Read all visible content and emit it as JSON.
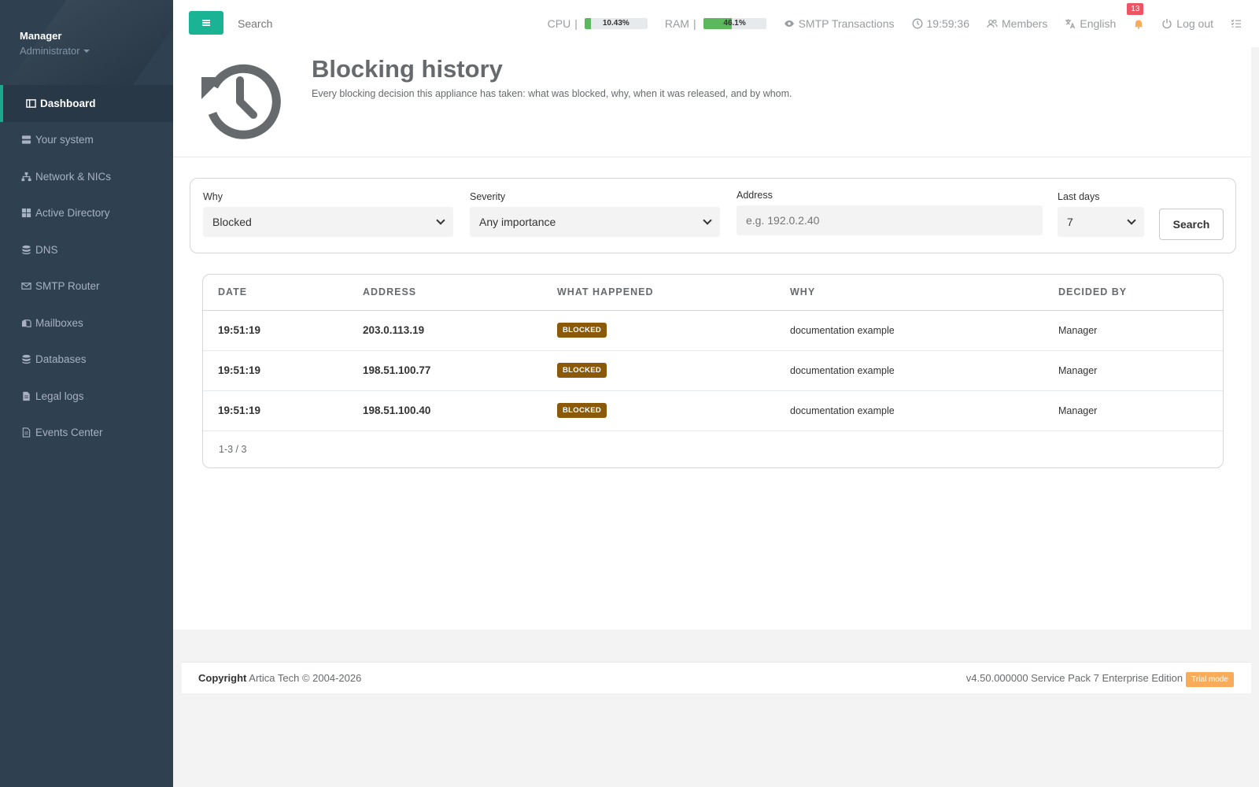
{
  "sidebar": {
    "user_name": "Manager",
    "user_role": "Administrator",
    "items": [
      {
        "label": "Dashboard",
        "icon": "dashboard-icon"
      },
      {
        "label": "Your system",
        "icon": "server-icon"
      },
      {
        "label": "Network & NICs",
        "icon": "network-icon"
      },
      {
        "label": "Active Directory",
        "icon": "windows-icon"
      },
      {
        "label": "DNS",
        "icon": "database-icon"
      },
      {
        "label": "SMTP Router",
        "icon": "envelope-icon"
      },
      {
        "label": "Mailboxes",
        "icon": "mailbox-icon"
      },
      {
        "label": "Databases",
        "icon": "database-icon"
      },
      {
        "label": "Legal logs",
        "icon": "file-icon"
      },
      {
        "label": "Events Center",
        "icon": "file-list-icon"
      }
    ]
  },
  "topbar": {
    "search_placeholder": "Search",
    "cpu_label": "CPU",
    "cpu_value": "10.43%",
    "cpu_fraction": 0.1043,
    "ram_label": "RAM",
    "ram_value": "46.1%",
    "ram_fraction": 0.461,
    "smtp_label": "SMTP Transactions",
    "time": "19:59:36",
    "members_label": "Members",
    "language": "English",
    "notifications_count": "13",
    "logout_label": "Log out"
  },
  "header": {
    "title": "Blocking history",
    "description": "Every blocking decision this appliance has taken: what was blocked, why, when it was released, and by whom."
  },
  "filters": {
    "why_label": "Why",
    "why_value": "Blocked",
    "severity_label": "Severity",
    "severity_value": "Any importance",
    "address_label": "Address",
    "address_placeholder": "e.g. 192.0.2.40",
    "last_days_label": "Last days",
    "last_days_value": "7",
    "search_button": "Search"
  },
  "table": {
    "columns": [
      "DATE",
      "ADDRESS",
      "WHAT HAPPENED",
      "WHY",
      "DECIDED BY"
    ],
    "rows": [
      {
        "date": "19:51:19",
        "address": "203.0.113.19",
        "status": "BLOCKED",
        "why": "documentation example",
        "who": "Manager"
      },
      {
        "date": "19:51:19",
        "address": "198.51.100.77",
        "status": "BLOCKED",
        "why": "documentation example",
        "who": "Manager"
      },
      {
        "date": "19:51:19",
        "address": "198.51.100.40",
        "status": "BLOCKED",
        "why": "documentation example",
        "who": "Manager"
      }
    ],
    "pager": "1-3 / 3"
  },
  "footer": {
    "copyright_label": "Copyright",
    "copyright_text": "Artica Tech © 2004-2026",
    "version": "v4.50.000000 Service Pack 7 Enterprise Edition",
    "trial": "Trial mode"
  },
  "colors": {
    "accent": "#1ab394",
    "sidebar_bg": "#2f4050",
    "blocked_badge": "#8a5a0a",
    "meter_fill": "#5cb85c",
    "notification_badge": "#ed5565",
    "trial_badge": "#f8ac59"
  }
}
